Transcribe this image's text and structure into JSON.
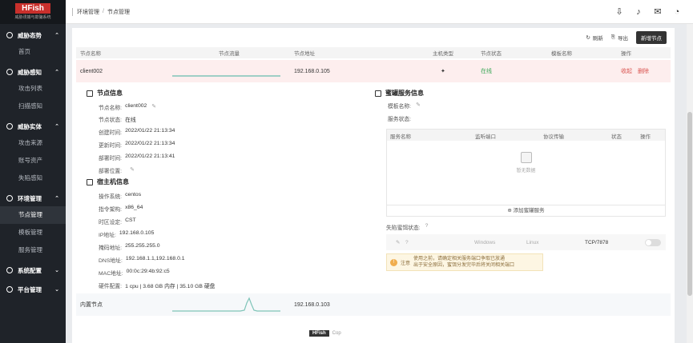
{
  "app": {
    "brand": "HFish",
    "subtitle": "威胁诱捕与欺骗系统"
  },
  "sidebar": {
    "groups": [
      {
        "title": "威胁态势",
        "items": [
          "首页"
        ]
      },
      {
        "title": "威胁感知",
        "items": [
          "攻击列表",
          "扫描感知"
        ]
      },
      {
        "title": "威胁实体",
        "items": [
          "攻击来源",
          "账号资产",
          "失陷感知"
        ]
      },
      {
        "title": "环境管理",
        "items": [
          "节点管理",
          "模板管理",
          "服务管理"
        ]
      },
      {
        "title": "系统配置",
        "items": []
      },
      {
        "title": "平台管理",
        "items": []
      }
    ],
    "active_item": "节点管理"
  },
  "breadcrumb": {
    "parent": "环境管理",
    "separator": "/",
    "current": "节点管理"
  },
  "toolbar": {
    "refresh": "刷新",
    "export": "导出",
    "add_node": "新增节点"
  },
  "table": {
    "headers": {
      "name": "节点名称",
      "flow": "节点流量",
      "address": "节点地址",
      "type": "主机类型",
      "status": "节点状态",
      "template": "模板名称",
      "ops": "操作"
    },
    "rows": [
      {
        "name": "client002",
        "address": "192.168.0.105",
        "status": "在线",
        "op1": "收起",
        "op2": "删除"
      },
      {
        "name": "内置节点",
        "address": "192.168.0.103"
      }
    ]
  },
  "node_info": {
    "title": "节点信息",
    "fields": [
      {
        "k": "节点名称:",
        "v": "client002"
      },
      {
        "k": "节点状态:",
        "v": "在线"
      },
      {
        "k": "创建时间:",
        "v": "2022/01/22 21:13:34"
      },
      {
        "k": "更新时间:",
        "v": "2022/01/22 21:13:34"
      },
      {
        "k": "部署时间:",
        "v": "2022/01/22 21:13:41"
      },
      {
        "k": "部署位置:",
        "v": ""
      }
    ]
  },
  "host_info": {
    "title": "宿主机信息",
    "fields": [
      {
        "k": "操作系统:",
        "v": "centos"
      },
      {
        "k": "指令架构:",
        "v": "x86_64"
      },
      {
        "k": "时区设定:",
        "v": "CST"
      },
      {
        "k": "IP地址:",
        "v": "192.168.0.105"
      },
      {
        "k": "掩码地址:",
        "v": "255.255.255.0"
      },
      {
        "k": "DNS地址:",
        "v": "192.168.1.1,192.168.0.1"
      },
      {
        "k": "MAC地址:",
        "v": "00:0c:29:4b:92:c5"
      },
      {
        "k": "硬件配置:",
        "v": "1 cpu | 3.68 GB 内存 | 35.10 GB 硬盘"
      }
    ]
  },
  "honeypot": {
    "title": "蜜罐服务信息",
    "template_label": "模板名称:",
    "service_status_label": "服务状态:",
    "table_headers": {
      "name": "服务名称",
      "port": "监听端口",
      "proto": "协议传输",
      "state": "状态",
      "ops": "操作"
    },
    "empty_text": "暂无数据",
    "add_service": "添加蜜罐服务",
    "trap_label": "失陷蜜饵状态:",
    "trap_row": {
      "windows": "Windows",
      "linux": "Linux",
      "port": "TCP/7878"
    },
    "notice_label": "注意",
    "notice_lines": [
      "使用之前，请确定相关服务端口争取已放通",
      "出于安全原因，蜜饵分发完毕后将关闭相关端口"
    ]
  },
  "footer": {
    "badge": "HFish",
    "text": "Cop"
  }
}
